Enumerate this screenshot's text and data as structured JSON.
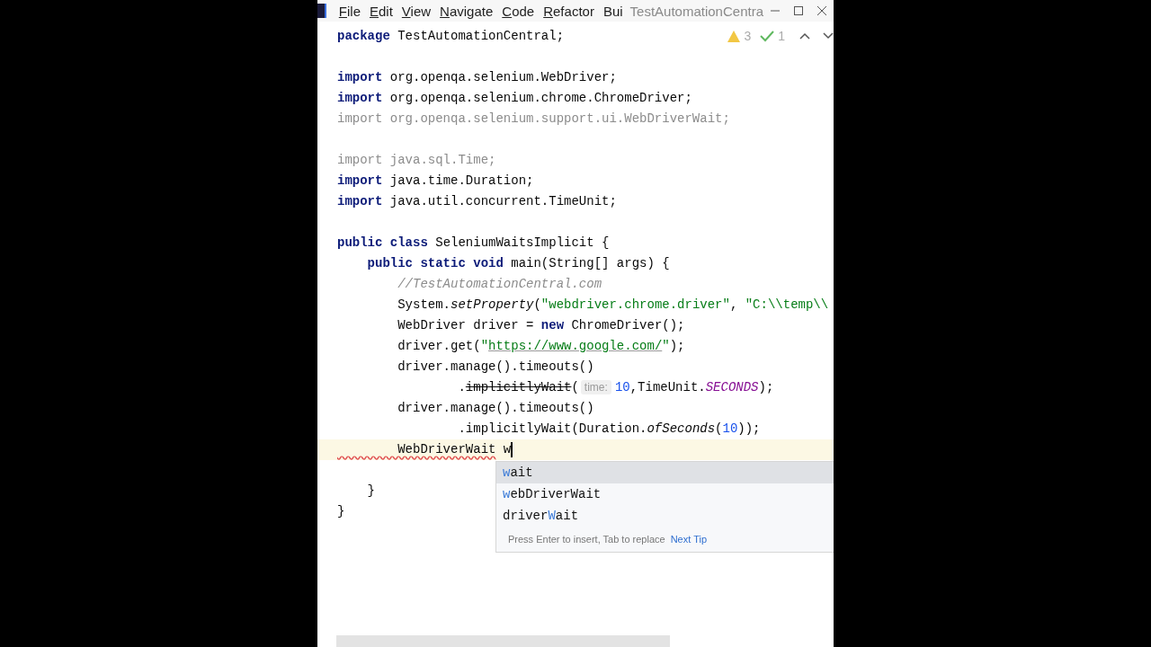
{
  "menu_bar": {
    "items": [
      {
        "key": "F",
        "rest": "ile"
      },
      {
        "key": "E",
        "rest": "dit"
      },
      {
        "key": "V",
        "rest": "iew"
      },
      {
        "key": "N",
        "rest": "avigate"
      },
      {
        "key": "C",
        "rest": "ode"
      },
      {
        "key": "R",
        "rest": "efactor"
      },
      {
        "rest": "Bui"
      }
    ],
    "title": "TestAutomationCentra"
  },
  "inspections": {
    "warnings": "3",
    "typos": "1"
  },
  "editor": {
    "lines": [
      {
        "current": false,
        "tokens": [
          {
            "kind": "keyword",
            "text": "package"
          },
          {
            "kind": "plain",
            "text": " TestAutomationCentral;"
          }
        ]
      },
      {
        "current": false
      },
      {
        "current": false,
        "tokens": [
          {
            "kind": "keyword",
            "text": "import"
          },
          {
            "kind": "plain",
            "text": " org.openqa.selenium.WebDriver;"
          }
        ]
      },
      {
        "current": false,
        "tokens": [
          {
            "kind": "keyword",
            "text": "import"
          },
          {
            "kind": "plain",
            "text": " org.openqa.selenium.chrome.ChromeDriver;"
          }
        ]
      },
      {
        "current": false,
        "tokens": [
          {
            "kind": "unused",
            "text": "import org.openqa.selenium.support.ui.WebDriverWait;"
          }
        ]
      },
      {
        "current": false
      },
      {
        "current": false,
        "tokens": [
          {
            "kind": "unused",
            "text": "import java.sql.Time;"
          }
        ]
      },
      {
        "current": false,
        "tokens": [
          {
            "kind": "keyword",
            "text": "import"
          },
          {
            "kind": "plain",
            "text": " java.time.Duration;"
          }
        ]
      },
      {
        "current": false,
        "tokens": [
          {
            "kind": "keyword",
            "text": "import"
          },
          {
            "kind": "plain",
            "text": " java.util.concurrent.TimeUnit;"
          }
        ]
      },
      {
        "current": false
      },
      {
        "current": false,
        "tokens": [
          {
            "kind": "keyword",
            "text": "public class"
          },
          {
            "kind": "plain",
            "text": " SeleniumWaitsImplicit {"
          }
        ]
      },
      {
        "current": false,
        "tokens": [
          {
            "kind": "keyword",
            "text": "    public static void"
          },
          {
            "kind": "plain",
            "text": " main(String[] args) {"
          }
        ]
      },
      {
        "current": false,
        "tokens": [
          {
            "kind": "comment",
            "text": "        //TestAutomationCentral.com"
          }
        ]
      },
      {
        "current": false,
        "tokens": [
          {
            "kind": "plain",
            "text": "        System."
          },
          {
            "kind": "italic",
            "text": "setProperty"
          },
          {
            "kind": "plain",
            "text": "("
          },
          {
            "kind": "string",
            "text": "\"webdriver.chrome.driver\""
          },
          {
            "kind": "plain",
            "text": ", "
          },
          {
            "kind": "string",
            "text": "\"C:\\\\temp\\\\"
          }
        ]
      },
      {
        "current": false,
        "tokens": [
          {
            "kind": "plain",
            "text": "        WebDriver driver = "
          },
          {
            "kind": "keyword",
            "text": "new"
          },
          {
            "kind": "plain",
            "text": " ChromeDriver();"
          }
        ]
      },
      {
        "current": false,
        "tokens": [
          {
            "kind": "plain",
            "text": "        driver.get("
          },
          {
            "kind": "string",
            "text": "\""
          },
          {
            "kind": "link",
            "text": "https://www.google.com/"
          },
          {
            "kind": "string",
            "text": "\""
          },
          {
            "kind": "plain",
            "text": ");"
          }
        ]
      },
      {
        "current": false,
        "tokens": [
          {
            "kind": "plain",
            "text": "        driver.manage().timeouts()"
          }
        ]
      },
      {
        "current": false,
        "tokens": [
          {
            "kind": "plain",
            "text": "                ."
          },
          {
            "kind": "strike",
            "text": "implicitlyWait"
          },
          {
            "kind": "plain",
            "text": "("
          },
          {
            "kind": "hint",
            "text": "time:"
          },
          {
            "kind": "number",
            "text": "10"
          },
          {
            "kind": "plain",
            "text": ",TimeUnit."
          },
          {
            "kind": "constant",
            "text": "SECONDS"
          },
          {
            "kind": "plain",
            "text": ");"
          }
        ]
      },
      {
        "current": false,
        "tokens": [
          {
            "kind": "plain",
            "text": "        driver.manage().timeouts()"
          }
        ]
      },
      {
        "current": false,
        "tokens": [
          {
            "kind": "plain",
            "text": "                .implicitlyWait(Duration."
          },
          {
            "kind": "italic",
            "text": "ofSeconds"
          },
          {
            "kind": "plain",
            "text": "("
          },
          {
            "kind": "number",
            "text": "10"
          },
          {
            "kind": "plain",
            "text": "));"
          }
        ]
      },
      {
        "current": true,
        "tokens": [
          {
            "kind": "error",
            "text": "        WebDriverWait"
          },
          {
            "kind": "plain",
            "text": " w"
          }
        ]
      },
      {
        "current": false
      },
      {
        "current": false,
        "tokens": [
          {
            "kind": "plain",
            "text": "    }"
          }
        ]
      },
      {
        "current": false,
        "tokens": [
          {
            "kind": "plain",
            "text": "}"
          }
        ]
      }
    ]
  },
  "completion": {
    "items": [
      {
        "selected": true,
        "parts": [
          {
            "text": "w",
            "match": true
          },
          {
            "text": "ait",
            "match": false
          }
        ]
      },
      {
        "selected": false,
        "parts": [
          {
            "text": "w",
            "match": true
          },
          {
            "text": "ebDriverWait",
            "match": false
          }
        ]
      },
      {
        "selected": false,
        "parts": [
          {
            "text": "driver",
            "match": false
          },
          {
            "text": "W",
            "match": true
          },
          {
            "text": "ait",
            "match": false
          }
        ]
      }
    ],
    "footer": "Press Enter to insert, Tab to replace",
    "tip_link": "Next Tip"
  }
}
